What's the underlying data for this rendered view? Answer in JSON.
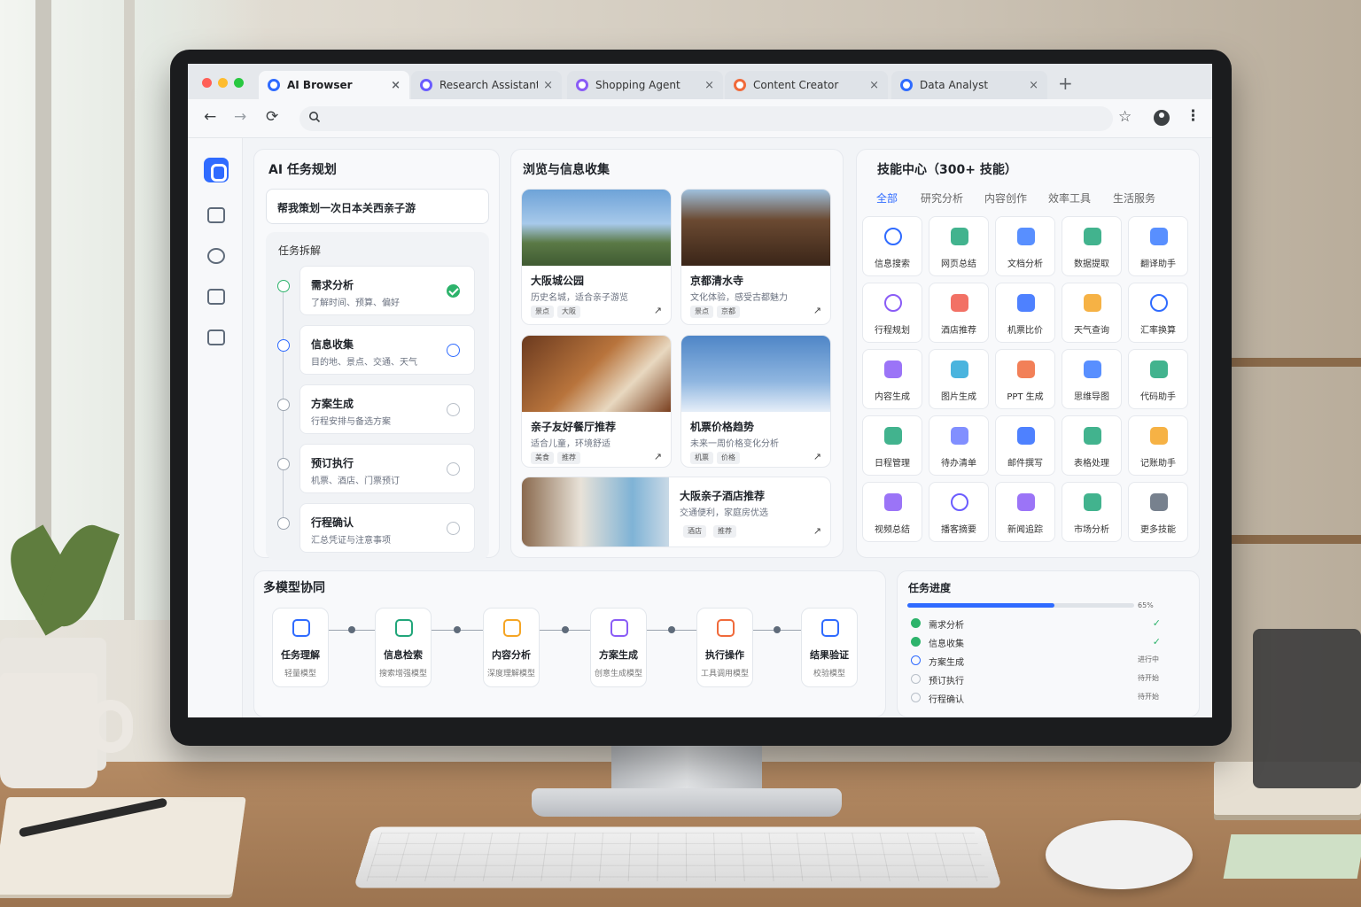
{
  "browser": {
    "tabs": [
      {
        "label": "AI Browser",
        "color": "#2f6bff",
        "active": true
      },
      {
        "label": "Research Assistant",
        "color": "#6b5cff",
        "active": false
      },
      {
        "label": "Shopping Agent",
        "color": "#8a5cf6",
        "active": false
      },
      {
        "label": "Content Creator",
        "color": "#f06a3b",
        "active": false
      },
      {
        "label": "Data Analyst",
        "color": "#2f6bff",
        "active": false
      }
    ],
    "close_glyph": "×",
    "new_tab_glyph": "+",
    "nav": {
      "back": "←",
      "forward": "→",
      "reload": "⟳",
      "star": "☆",
      "menu": "⋮"
    }
  },
  "planning": {
    "title": "AI 任务规划",
    "query": "帮我策划一次日本关西亲子游",
    "breakdown_title": "任务拆解",
    "steps": [
      {
        "name": "需求分析",
        "desc": "了解时间、预算、偏好",
        "state": "done"
      },
      {
        "name": "信息收集",
        "desc": "目的地、景点、交通、天气",
        "state": "active"
      },
      {
        "name": "方案生成",
        "desc": "行程安排与备选方案",
        "state": "pending"
      },
      {
        "name": "预订执行",
        "desc": "机票、酒店、门票预订",
        "state": "pending"
      },
      {
        "name": "行程确认",
        "desc": "汇总凭证与注意事项",
        "state": "pending"
      }
    ]
  },
  "browse": {
    "title": "浏览与信息收集",
    "cards": [
      {
        "title": "大阪城公园",
        "desc": "历史名城，适合亲子游览",
        "tags": [
          "景点",
          "大阪"
        ]
      },
      {
        "title": "京都清水寺",
        "desc": "文化体验，感受古都魅力",
        "tags": [
          "景点",
          "京都"
        ]
      },
      {
        "title": "亲子友好餐厅推荐",
        "desc": "适合儿童，环境舒适",
        "tags": [
          "美食",
          "推荐"
        ]
      },
      {
        "title": "机票价格趋势",
        "desc": "未来一周价格变化分析",
        "tags": [
          "机票",
          "价格"
        ]
      },
      {
        "title": "大阪亲子酒店推荐",
        "desc": "交通便利，家庭房优选",
        "tags": [
          "酒店",
          "推荐"
        ]
      }
    ],
    "external_glyph": "↗"
  },
  "skills": {
    "title": "技能中心（300+ 技能）",
    "tabs": [
      "全部",
      "研究分析",
      "内容创作",
      "效率工具",
      "生活服务"
    ],
    "items": [
      {
        "label": "信息搜索",
        "icon": "search-icon",
        "color": "#2f6bff"
      },
      {
        "label": "网页总结",
        "icon": "webpage-summary-icon",
        "color": "#21a67a"
      },
      {
        "label": "文档分析",
        "icon": "document-icon",
        "color": "#3b7bff"
      },
      {
        "label": "数据提取",
        "icon": "data-extract-icon",
        "color": "#21a67a"
      },
      {
        "label": "翻译助手",
        "icon": "translate-icon",
        "color": "#3b7bff"
      },
      {
        "label": "行程规划",
        "icon": "route-icon",
        "color": "#8a5cf6"
      },
      {
        "label": "酒店推荐",
        "icon": "hotel-icon",
        "color": "#f0584a"
      },
      {
        "label": "机票比价",
        "icon": "airplane-icon",
        "color": "#2f6bff"
      },
      {
        "label": "天气查询",
        "icon": "weather-icon",
        "color": "#f5a524"
      },
      {
        "label": "汇率换算",
        "icon": "currency-icon",
        "color": "#2f6bff"
      },
      {
        "label": "内容生成",
        "icon": "content-icon",
        "color": "#8a5cf6"
      },
      {
        "label": "图片生成",
        "icon": "image-icon",
        "color": "#2aa7d8"
      },
      {
        "label": "PPT 生成",
        "icon": "ppt-icon",
        "color": "#f06a3b"
      },
      {
        "label": "思维导图",
        "icon": "mindmap-icon",
        "color": "#3b7bff"
      },
      {
        "label": "代码助手",
        "icon": "code-icon",
        "color": "#21a67a"
      },
      {
        "label": "日程管理",
        "icon": "calendar-icon",
        "color": "#21a67a"
      },
      {
        "label": "待办清单",
        "icon": "todo-icon",
        "color": "#6b7bff"
      },
      {
        "label": "邮件撰写",
        "icon": "mail-icon",
        "color": "#2f6bff"
      },
      {
        "label": "表格处理",
        "icon": "table-icon",
        "color": "#21a67a"
      },
      {
        "label": "记账助手",
        "icon": "piggybank-icon",
        "color": "#f5a524"
      },
      {
        "label": "视频总结",
        "icon": "video-icon",
        "color": "#8a5cf6"
      },
      {
        "label": "播客摘要",
        "icon": "podcast-icon",
        "color": "#6b5cff"
      },
      {
        "label": "新闻追踪",
        "icon": "news-icon",
        "color": "#8a5cf6"
      },
      {
        "label": "市场分析",
        "icon": "chart-icon",
        "color": "#21a67a"
      },
      {
        "label": "更多技能",
        "icon": "grid-icon",
        "color": "#5f6b7a"
      }
    ]
  },
  "multimodel": {
    "title": "多模型协同",
    "nodes": [
      {
        "name": "任务理解",
        "model": "轻量模型",
        "color": "#2f6bff"
      },
      {
        "name": "信息检索",
        "model": "搜索增强模型",
        "color": "#21a67a"
      },
      {
        "name": "内容分析",
        "model": "深度理解模型",
        "color": "#f5a524"
      },
      {
        "name": "方案生成",
        "model": "创意生成模型",
        "color": "#8a5cf6"
      },
      {
        "name": "执行操作",
        "model": "工具调用模型",
        "color": "#f06a3b"
      },
      {
        "name": "结果验证",
        "model": "校验模型",
        "color": "#2f6bff"
      }
    ]
  },
  "progress": {
    "title": "任务进度",
    "percent": 65,
    "percent_label": "65%",
    "rows": [
      {
        "name": "需求分析",
        "state": "done",
        "status": "✓"
      },
      {
        "name": "信息收集",
        "state": "done",
        "status": "✓"
      },
      {
        "name": "方案生成",
        "state": "active",
        "status": "进行中"
      },
      {
        "name": "预订执行",
        "state": "pending",
        "status": "待开始"
      },
      {
        "name": "行程确认",
        "state": "pending",
        "status": "待开始"
      }
    ]
  },
  "colors": {
    "accent": "#2f6bff",
    "success": "#2db36b"
  }
}
